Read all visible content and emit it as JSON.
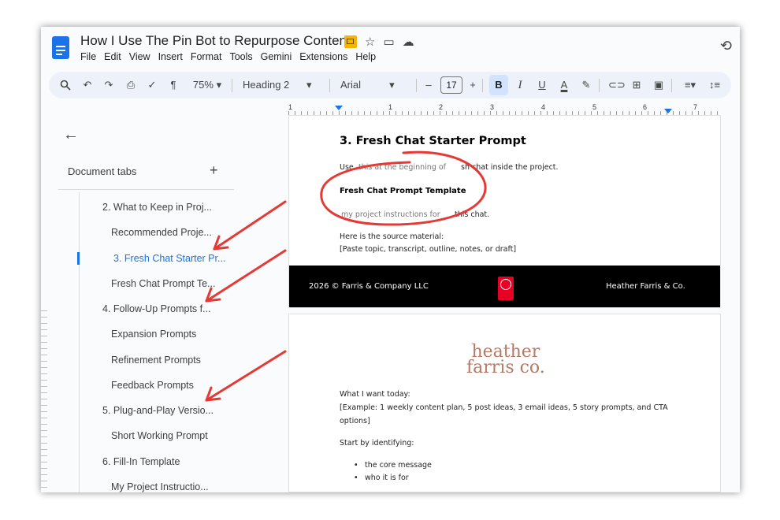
{
  "window": {
    "title": "How I Use The Pin Bot to Repurpose Content",
    "menu": [
      "File",
      "Edit",
      "View",
      "Insert",
      "Format",
      "Tools",
      "Gemini",
      "Extensions",
      "Help"
    ]
  },
  "toolbar": {
    "zoom": "75%",
    "style": "Heading 2",
    "font": "Arial",
    "font_size": "17",
    "minus": "–",
    "plus": "+",
    "bold": "B",
    "italic": "I",
    "underline": "U",
    "text_color": "A"
  },
  "ruler": {
    "numbers": [
      "1",
      "1",
      "2",
      "3",
      "4",
      "5",
      "6",
      "7"
    ]
  },
  "sidebar": {
    "heading": "Document tabs",
    "add": "+",
    "items": [
      {
        "label": "2. What to Keep in Proj...",
        "active": false
      },
      {
        "label": "Recommended Proje...",
        "active": false
      },
      {
        "label": "3. Fresh Chat Starter Pr...",
        "active": true
      },
      {
        "label": "Fresh Chat Prompt Te...",
        "active": false
      },
      {
        "label": "4. Follow-Up Prompts f...",
        "active": false
      },
      {
        "label": "Expansion Prompts",
        "active": false
      },
      {
        "label": "Refinement Prompts",
        "active": false
      },
      {
        "label": "Feedback Prompts",
        "active": false
      },
      {
        "label": "5. Plug-and-Play Versio...",
        "active": false
      },
      {
        "label": "Short Working Prompt",
        "active": false
      },
      {
        "label": "6. Fill-In Template",
        "active": false
      },
      {
        "label": "My Project Instructio...",
        "active": false
      }
    ]
  },
  "page1": {
    "heading": "3. Fresh Chat Starter Prompt",
    "intro_a": "Use",
    "intro_b": "this at the beginning of",
    "intro_c": "sh chat inside the project.",
    "subheading": "Fresh Chat Prompt Template",
    "line_a": "my project instructions for",
    "line_b": "this chat.",
    "source_label": "Here is the source material:",
    "source_placeholder": "[Paste topic, transcript, outline, notes, or draft]",
    "footer_left": "2026 © Farris & Company LLC",
    "footer_right": "Heather Farris & Co."
  },
  "page2": {
    "logo_top": "heather",
    "logo_bottom": "farris co.",
    "want_label": "What I want today:",
    "example_1": "[Example: 1 weekly content plan, 5 post ideas, 3 email ideas, 5 story prompts, and CTA",
    "example_2": "options]",
    "start": "Start by identifying:",
    "bullets": [
      "the core message",
      "who it is for"
    ]
  },
  "colors": {
    "accent_blue": "#1a73e8",
    "annotation_red": "#e53935",
    "footer_black": "#000000",
    "pinterest_red": "#e60023",
    "logo_rose": "#b57a66"
  }
}
